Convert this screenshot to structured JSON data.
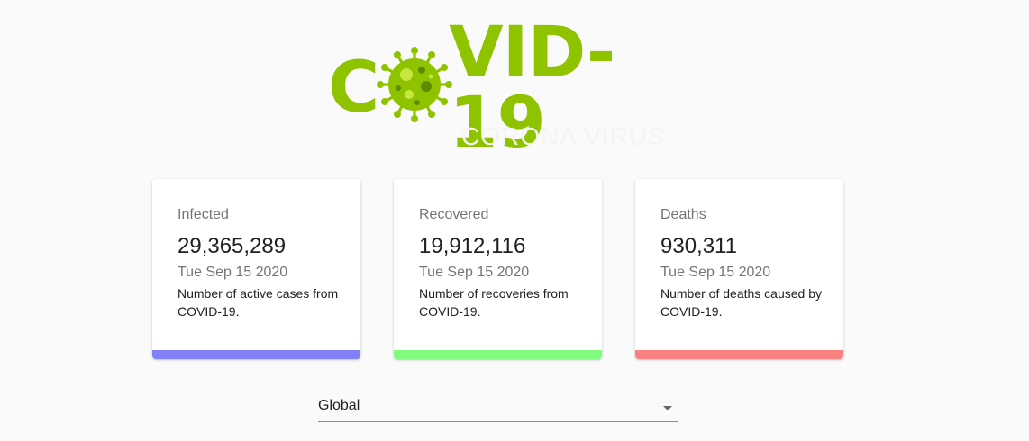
{
  "logo": {
    "title_left": "C",
    "title_right": "VID-19",
    "subtitle": "CORONA VIRUS",
    "icon": "virus-icon",
    "brand_color": "#8fc300"
  },
  "cards": [
    {
      "label": "Infected",
      "value": "29,365,289",
      "date": "Tue Sep 15 2020",
      "description": "Number of active cases from COVID-19.",
      "accent_color": "#8080f8"
    },
    {
      "label": "Recovered",
      "value": "19,912,116",
      "date": "Tue Sep 15 2020",
      "description": "Number of recoveries from COVID-19.",
      "accent_color": "#80fb80"
    },
    {
      "label": "Deaths",
      "value": "930,311",
      "date": "Tue Sep 15 2020",
      "description": "Number of deaths caused by COVID-19.",
      "accent_color": "#fb8080"
    }
  ],
  "country_select": {
    "selected": "Global",
    "icon": "chevron-down-icon"
  }
}
